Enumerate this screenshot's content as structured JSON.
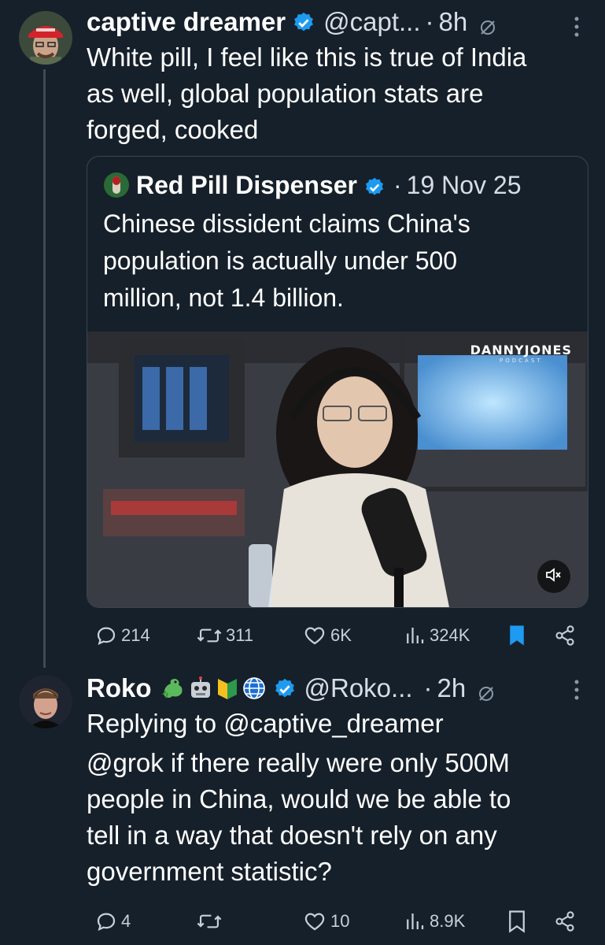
{
  "tweet1": {
    "name": "captive dreamer",
    "handle": "@capt...",
    "separator": "·",
    "time": "8h",
    "text_lines": [
      "White pill, I feel like this is true of India",
      "as well, global population stats are",
      "forged, cooked"
    ],
    "quote": {
      "name": "Red Pill Dispenser",
      "separator": "·",
      "date": "19 Nov 25",
      "text_lines": [
        "Chinese dissident claims China's",
        "population is actually under 500",
        "million, not 1.4 billion."
      ],
      "video_watermark": "DANNYJONES",
      "video_watermark_sub": "PODCAST"
    },
    "actions": {
      "replies": "214",
      "reposts": "311",
      "likes": "6K",
      "views": "324K"
    },
    "bookmarked": true
  },
  "tweet2": {
    "name": "Roko",
    "emojis": [
      "dragon-icon",
      "robot-icon",
      "beginner-icon",
      "globe-icon"
    ],
    "handle": "@Roko...",
    "separator": "·",
    "time": "2h",
    "reply_to_prefix": "Replying to ",
    "reply_to_handle": "@captive_dreamer",
    "text_lines": [
      "@grok if there really were only 500M",
      "people in China, would we be able to",
      "tell in a way that doesn't rely on any",
      "government statistic?"
    ],
    "actions": {
      "replies": "4",
      "reposts": "",
      "likes": "10",
      "views": "8.9K"
    },
    "bookmarked": false
  },
  "colors": {
    "background": "#16202b",
    "accent": "#1d9bf0",
    "verified": "#1d9bf0",
    "secondary_text": "#d6dde4"
  }
}
